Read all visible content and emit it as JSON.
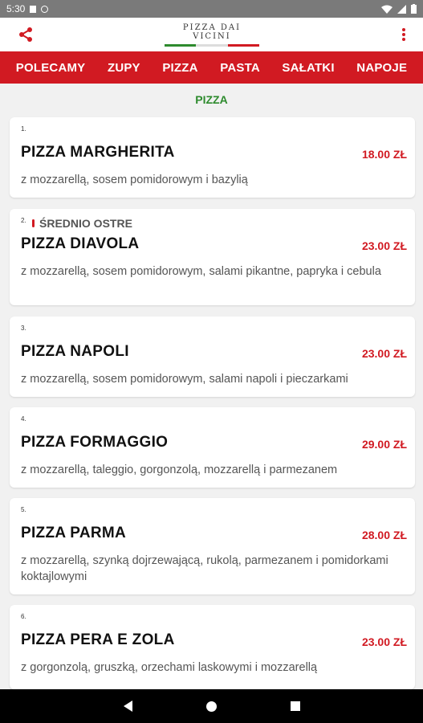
{
  "status_bar": {
    "time": "5:30"
  },
  "header": {
    "logo_text": "PIZZA DAI VICINI",
    "share_icon": "share-icon",
    "more_icon": "more-vert-icon",
    "flag_colors": [
      "#2e8b2e",
      "#ffffff",
      "#d11a22"
    ]
  },
  "categories": [
    "POLECAMY",
    "ZUPY",
    "PIZZA",
    "PASTA",
    "SAŁATKI",
    "NAPOJE"
  ],
  "section_title": "PIZZA",
  "items": [
    {
      "num": "1.",
      "name": "PIZZA MARGHERITA",
      "price": "18.00 ZŁ",
      "desc": "z mozzarellą, sosem pomidorowym i bazylią"
    },
    {
      "num": "2.",
      "spicy": "ŚREDNIO OSTRE",
      "name": "PIZZA DIAVOLA",
      "price": "23.00 ZŁ",
      "desc": "z mozzarellą, sosem pomidorowym, salami pikantne, papryka i cebula"
    },
    {
      "num": "3.",
      "name": "PIZZA NAPOLI",
      "price": "23.00 ZŁ",
      "desc": "z mozzarellą, sosem pomidorowym, salami napoli i pieczarkami"
    },
    {
      "num": "4.",
      "name": "PIZZA FORMAGGIO",
      "price": "29.00 ZŁ",
      "desc": "z mozzarellą, taleggio, gorgonzolą, mozzarellą i parmezanem"
    },
    {
      "num": "5.",
      "name": "PIZZA PARMA",
      "price": "28.00 ZŁ",
      "desc": "z mozzarellą, szynką dojrzewającą, rukolą, parmezanem i pomidorkami koktajlowymi"
    },
    {
      "num": "6.",
      "name": "PIZZA PERA E ZOLA",
      "price": "23.00 ZŁ",
      "desc": "z gorgonzolą, gruszką, orzechami laskowymi i mozzarellą"
    }
  ],
  "colors": {
    "accent": "#d11a22",
    "section": "#2e8b2e",
    "background": "#f1f1f1"
  }
}
